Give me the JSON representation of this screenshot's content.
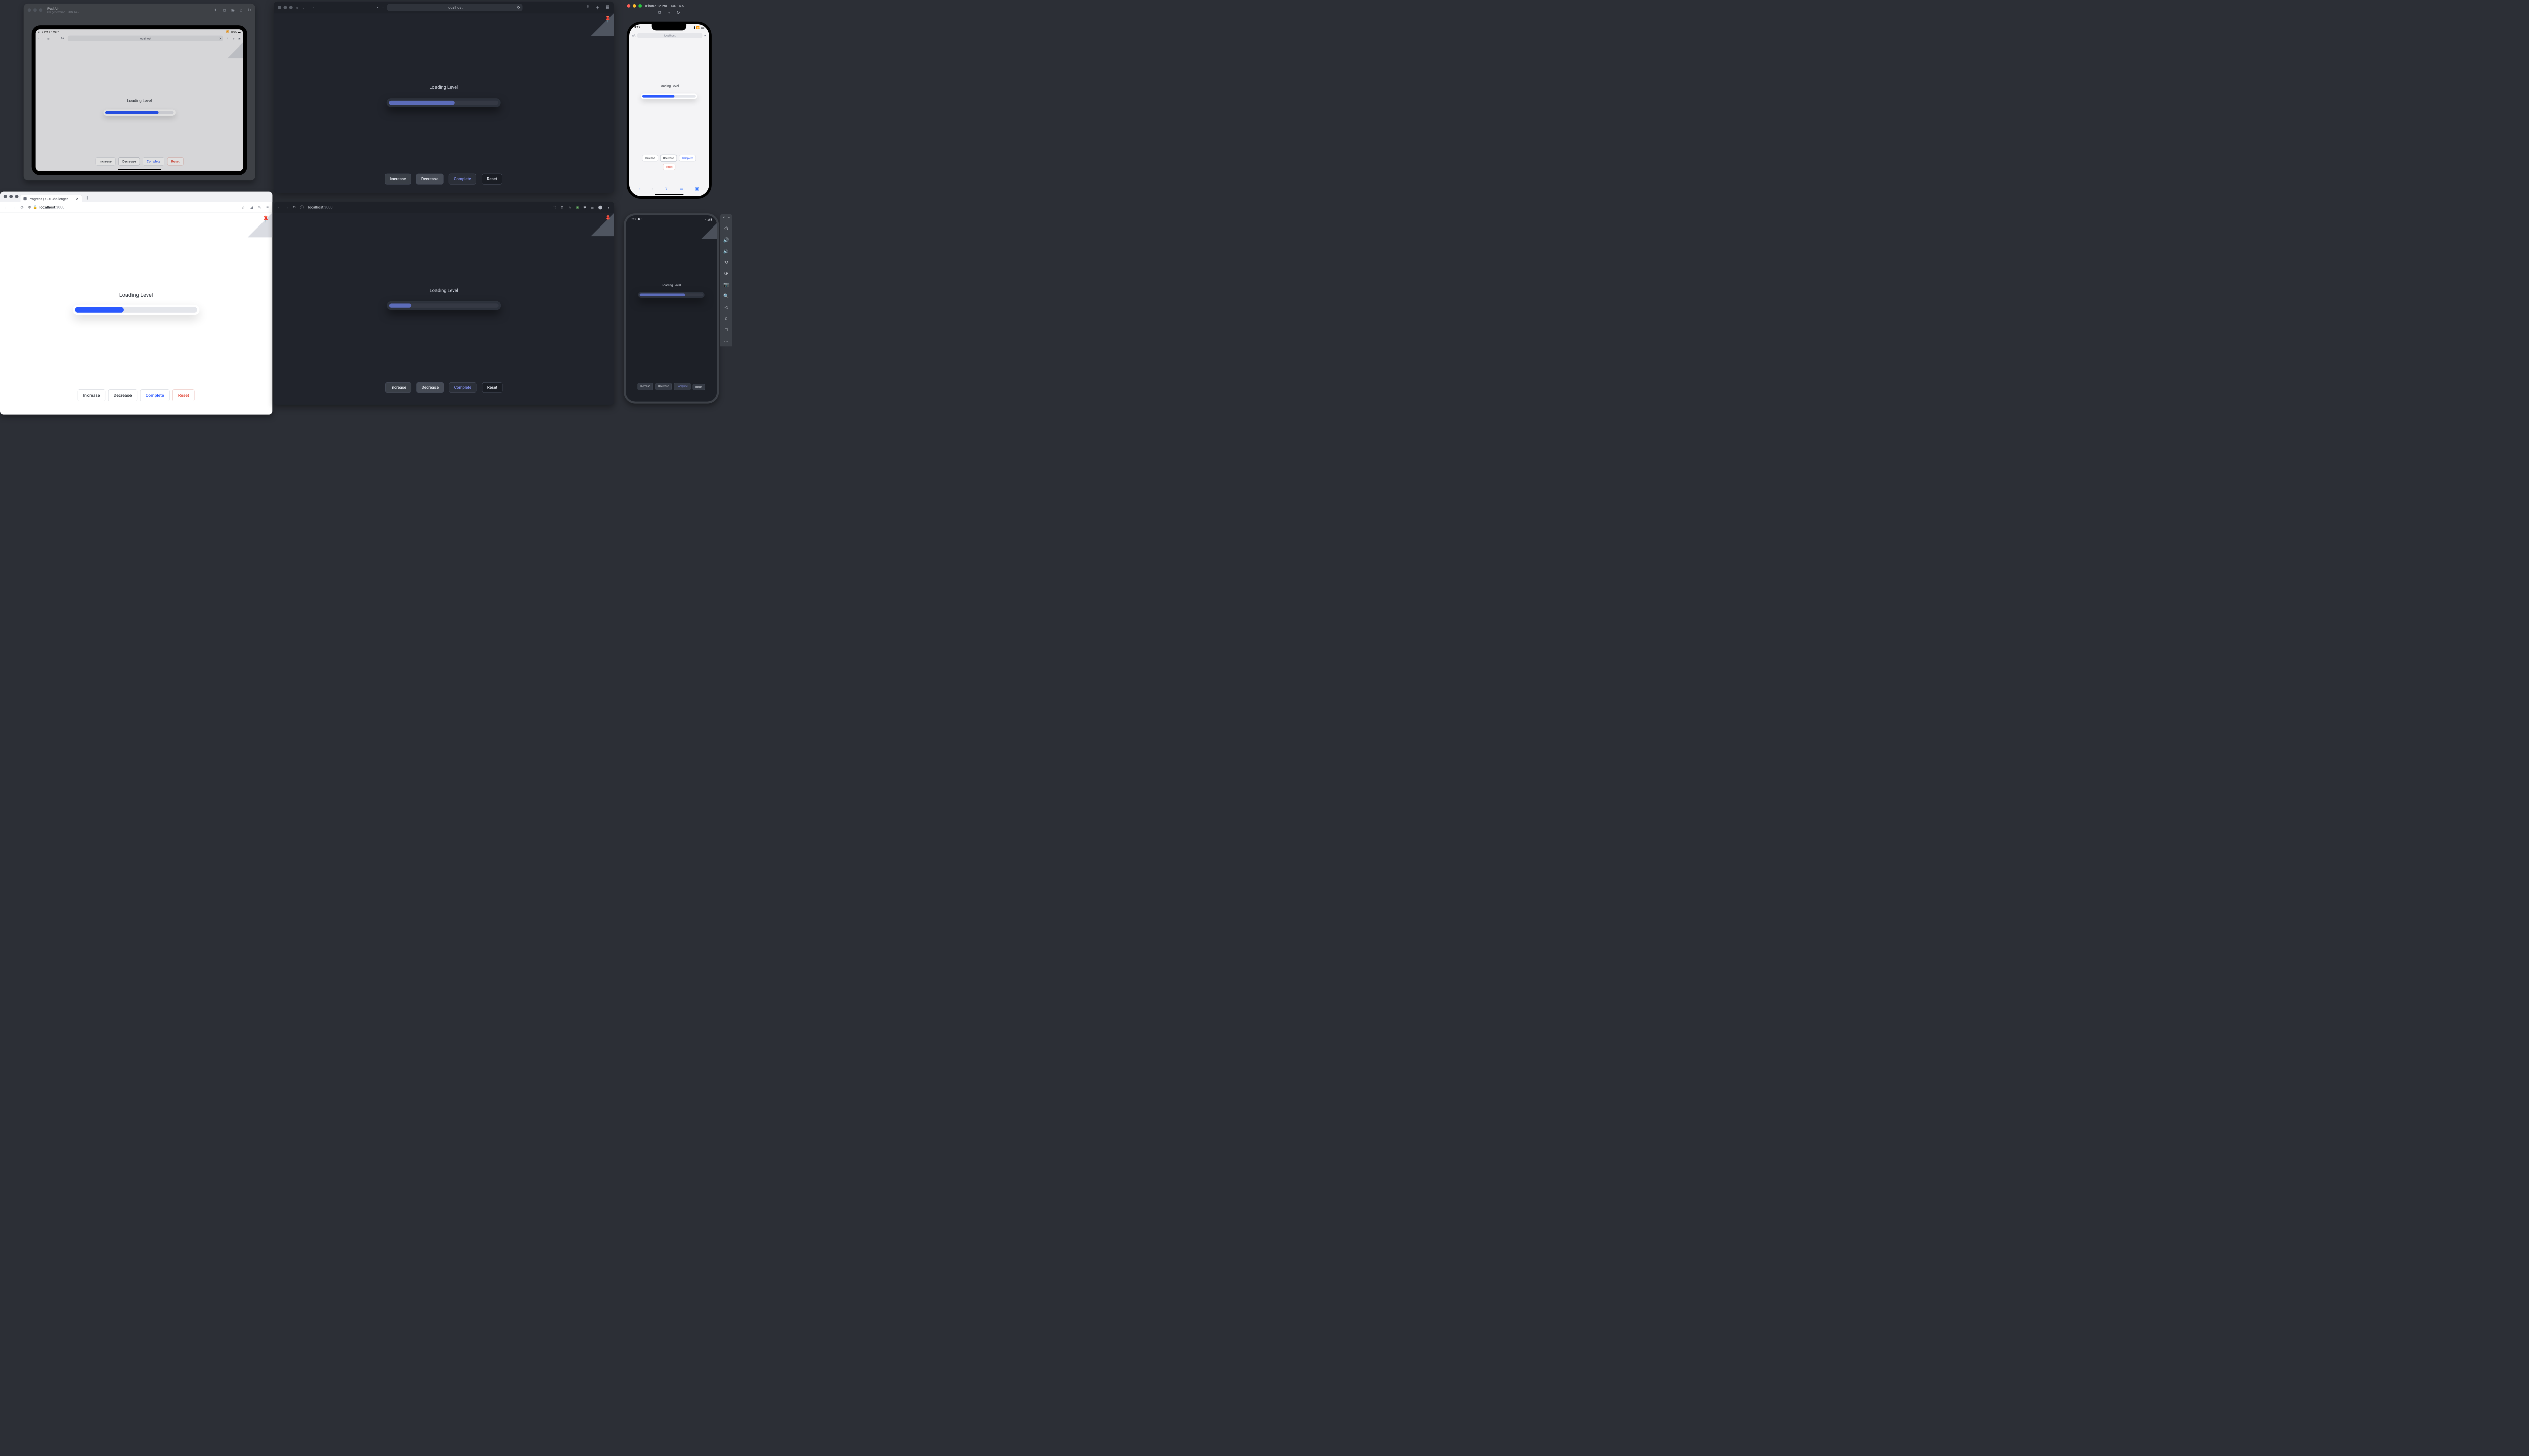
{
  "demo": {
    "label": "Loading Level",
    "buttons": {
      "increase": "Increase",
      "decrease": "Decrease",
      "complete": "Complete",
      "reset": "Reset"
    }
  },
  "progress": {
    "ipad_pct": 78,
    "safari_pct": 60,
    "iphone_pct": 60,
    "firefox_pct": 40,
    "chromium_pct": 20,
    "android_pct": 72
  },
  "ipad_sim": {
    "title": "iPad Air",
    "subtitle": "4th generation – iOS 14.5",
    "status": {
      "time": "3:19 PM",
      "date": "Fri Mar 4",
      "level": "100%"
    },
    "url_label": "localhost",
    "aa": "AA"
  },
  "safari": {
    "url_label": "localhost"
  },
  "iphone_sim": {
    "title": "iPhone 12 Pro – iOS 14.5",
    "status_time": "3:19",
    "url_label": "localhost",
    "aa": "AA"
  },
  "firefox": {
    "tab_title": "Progress | GUI Challenges",
    "host": "localhost",
    "port": ":3000"
  },
  "chromium": {
    "host": "localhost",
    "port": ":3000"
  },
  "android": {
    "status_time": "3:19",
    "status_icon_label": "8"
  }
}
